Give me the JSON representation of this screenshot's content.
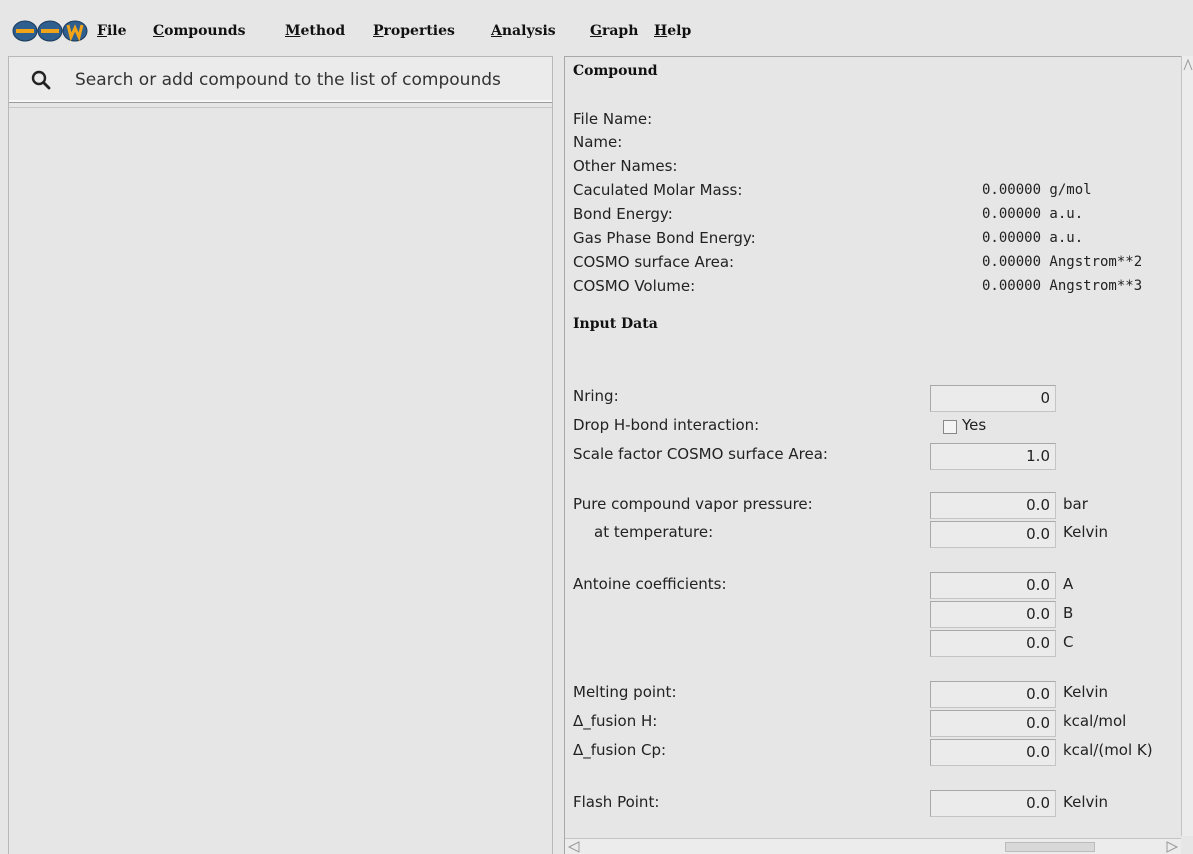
{
  "menubar": {
    "logo": "scm-logo",
    "items": [
      {
        "key": "F",
        "rest": "ile"
      },
      {
        "key": "C",
        "rest": "ompounds"
      },
      {
        "key": "M",
        "rest": "ethod"
      },
      {
        "key": "P",
        "rest": "roperties"
      },
      {
        "key": "A",
        "rest": "nalysis"
      },
      {
        "key": "G",
        "rest": "raph"
      },
      {
        "key": "H",
        "rest": "elp"
      }
    ]
  },
  "search": {
    "icon": "search-icon",
    "placeholder": "Search or add compound to the list of compounds"
  },
  "compound": {
    "title": "Compound",
    "file_name_label": "File Name:",
    "name_label": "Name:",
    "other_names_label": "Other Names:",
    "rows": [
      {
        "label": "Caculated Molar Mass:",
        "value": "0.00000 g/mol"
      },
      {
        "label": "Bond Energy:",
        "value": "0.00000 a.u."
      },
      {
        "label": "Gas Phase Bond Energy:",
        "value": "0.00000 a.u."
      },
      {
        "label": "COSMO surface Area:",
        "value": "0.00000 Angstrom**2"
      },
      {
        "label": "COSMO Volume:",
        "value": "0.00000 Angstrom**3"
      }
    ]
  },
  "input_data": {
    "title": "Input Data",
    "nring": {
      "label": "Nring:",
      "value": "0"
    },
    "drop_hbond": {
      "label": "Drop H-bond interaction:",
      "option": "Yes",
      "checked": false
    },
    "scale_factor": {
      "label": "Scale factor COSMO surface Area:",
      "value": "1.0"
    },
    "vapor_pressure": {
      "label": "Pure compound vapor pressure:",
      "value": "0.0",
      "unit": "bar"
    },
    "temperature": {
      "label": "at temperature:",
      "value": "0.0",
      "unit": "Kelvin"
    },
    "antoine": {
      "label": "Antoine coefficients:",
      "coefficients": [
        {
          "value": "0.0",
          "unit": "A"
        },
        {
          "value": "0.0",
          "unit": "B"
        },
        {
          "value": "0.0",
          "unit": "C"
        }
      ]
    },
    "melting_point": {
      "label": "Melting point:",
      "value": "0.0",
      "unit": "Kelvin"
    },
    "fusion_h": {
      "label": "Δ_fusion H:",
      "value": "0.0",
      "unit": "kcal/mol"
    },
    "fusion_cp": {
      "label": "Δ_fusion Cp:",
      "value": "0.0",
      "unit": "kcal/(mol K)"
    },
    "flash_point": {
      "label": "Flash Point:",
      "value": "0.0",
      "unit": "Kelvin"
    }
  }
}
